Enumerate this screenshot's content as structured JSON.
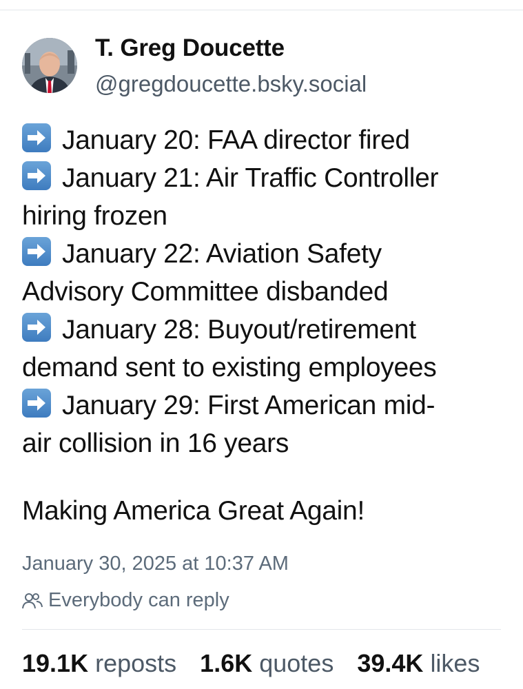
{
  "author": {
    "display_name": "T. Greg Doucette",
    "handle": "@gregdoucette.bsky.social",
    "avatar_icon": "profile-photo"
  },
  "post": {
    "lines": [
      {
        "arrow": true,
        "text": "January 20: FAA director fired"
      },
      {
        "arrow": true,
        "text": "January 21: Air Traffic Controller"
      },
      {
        "arrow": false,
        "text": "hiring frozen"
      },
      {
        "arrow": true,
        "text": "January 22: Aviation Safety"
      },
      {
        "arrow": false,
        "text": "Advisory Committee disbanded"
      },
      {
        "arrow": true,
        "text": "January 28: Buyout/retirement"
      },
      {
        "arrow": false,
        "text": "demand sent to existing employees"
      },
      {
        "arrow": true,
        "text": "January 29: First American mid-"
      },
      {
        "arrow": false,
        "text": "air collision in 16 years"
      }
    ],
    "arrow_icon": "right-arrow-emoji",
    "closing": "Making America Great Again!"
  },
  "meta": {
    "timestamp": "January 30, 2025 at 10:37 AM",
    "reply_setting": "Everybody can reply",
    "reply_icon": "people-icon"
  },
  "stats": {
    "reposts_count": "19.1K",
    "reposts_label": "reposts",
    "quotes_count": "1.6K",
    "quotes_label": "quotes",
    "likes_count": "39.4K",
    "likes_label": "likes"
  },
  "colors": {
    "text": "#111111",
    "secondary": "#5c6b7a",
    "arrow_bg": "#4a87c8",
    "divider": "#e3e6ea"
  }
}
